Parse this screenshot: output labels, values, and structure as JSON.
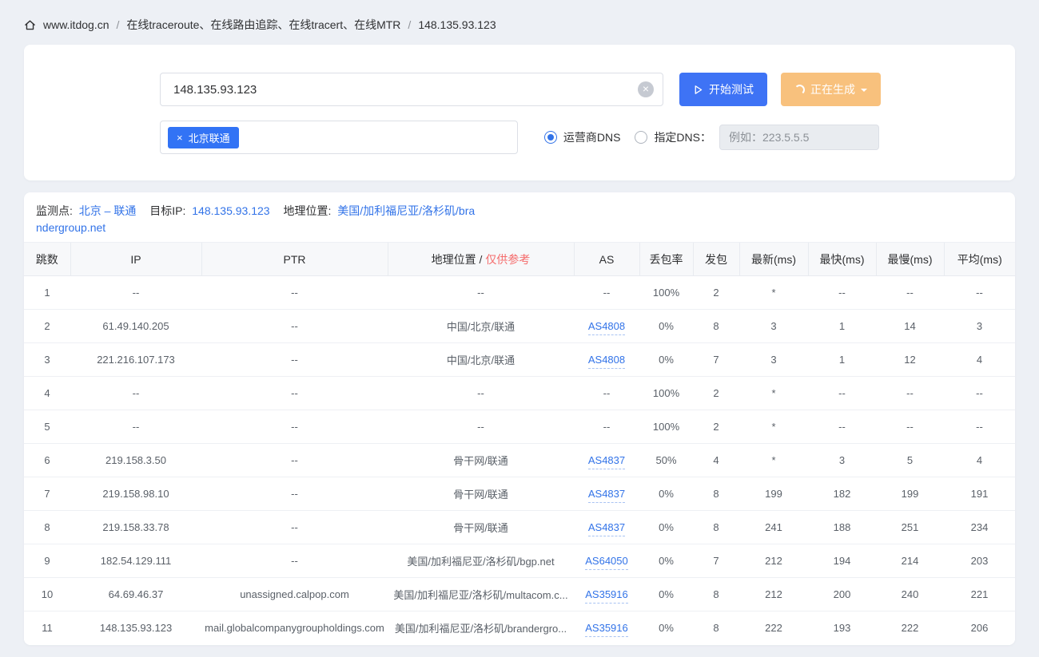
{
  "colors": {
    "accent_blue": "#3273e8",
    "button_blue": "#3e73f5",
    "generating_orange": "#f8c17d",
    "tag_blue": "#3273f5",
    "note_red": "#f56c6c",
    "page_background": "#edf0f5"
  },
  "breadcrumb": {
    "site": "www.itdog.cn",
    "sep1": "/",
    "section": "在线traceroute、在线路由追踪、在线tracert、在线MTR",
    "sep2": "/",
    "current": "148.135.93.123"
  },
  "controls": {
    "target_value": "148.135.93.123",
    "clear_glyph": "×",
    "start_label": "开始测试",
    "generating_label": "正在生成",
    "tag_close_glyph": "×",
    "tag_label": "北京联通",
    "radio_carrier_label": "运营商DNS",
    "radio_custom_label": "指定DNS：",
    "dns_example_value": "例如：223.5.5.5"
  },
  "result": {
    "monitor_label": "监测点:",
    "monitor_value": "北京 – 联通",
    "target_label": "目标IP:",
    "target_value": "148.135.93.123",
    "geo_label": "地理位置:",
    "geo_value": "美国/加利福尼亚/洛杉矶/brandergroup.net"
  },
  "table": {
    "headers": [
      "跳数",
      "IP",
      "PTR",
      "地理位置 / ",
      "AS",
      "丢包率",
      "发包",
      "最新(ms)",
      "最快(ms)",
      "最慢(ms)",
      "平均(ms)"
    ],
    "geo_note": "仅供参考",
    "rows": [
      {
        "hop": "1",
        "ip": "--",
        "ptr": "--",
        "geo": "--",
        "as": "--",
        "loss": "100%",
        "sent": "2",
        "latest": "*",
        "fastest": "--",
        "slowest": "--",
        "avg": "--"
      },
      {
        "hop": "2",
        "ip": "61.49.140.205",
        "ptr": "--",
        "geo": "中国/北京/联通",
        "as": "AS4808",
        "loss": "0%",
        "sent": "8",
        "latest": "3",
        "fastest": "1",
        "slowest": "14",
        "avg": "3"
      },
      {
        "hop": "3",
        "ip": "221.216.107.173",
        "ptr": "--",
        "geo": "中国/北京/联通",
        "as": "AS4808",
        "loss": "0%",
        "sent": "7",
        "latest": "3",
        "fastest": "1",
        "slowest": "12",
        "avg": "4"
      },
      {
        "hop": "4",
        "ip": "--",
        "ptr": "--",
        "geo": "--",
        "as": "--",
        "loss": "100%",
        "sent": "2",
        "latest": "*",
        "fastest": "--",
        "slowest": "--",
        "avg": "--"
      },
      {
        "hop": "5",
        "ip": "--",
        "ptr": "--",
        "geo": "--",
        "as": "--",
        "loss": "100%",
        "sent": "2",
        "latest": "*",
        "fastest": "--",
        "slowest": "--",
        "avg": "--"
      },
      {
        "hop": "6",
        "ip": "219.158.3.50",
        "ptr": "--",
        "geo": "骨干网/联通",
        "as": "AS4837",
        "loss": "50%",
        "sent": "4",
        "latest": "*",
        "fastest": "3",
        "slowest": "5",
        "avg": "4"
      },
      {
        "hop": "7",
        "ip": "219.158.98.10",
        "ptr": "--",
        "geo": "骨干网/联通",
        "as": "AS4837",
        "loss": "0%",
        "sent": "8",
        "latest": "199",
        "fastest": "182",
        "slowest": "199",
        "avg": "191"
      },
      {
        "hop": "8",
        "ip": "219.158.33.78",
        "ptr": "--",
        "geo": "骨干网/联通",
        "as": "AS4837",
        "loss": "0%",
        "sent": "8",
        "latest": "241",
        "fastest": "188",
        "slowest": "251",
        "avg": "234"
      },
      {
        "hop": "9",
        "ip": "182.54.129.111",
        "ptr": "--",
        "geo": "美国/加利福尼亚/洛杉矶/bgp.net",
        "as": "AS64050",
        "loss": "0%",
        "sent": "7",
        "latest": "212",
        "fastest": "194",
        "slowest": "214",
        "avg": "203"
      },
      {
        "hop": "10",
        "ip": "64.69.46.37",
        "ptr": "unassigned.calpop.com",
        "geo": "美国/加利福尼亚/洛杉矶/multacom.c...",
        "as": "AS35916",
        "loss": "0%",
        "sent": "8",
        "latest": "212",
        "fastest": "200",
        "slowest": "240",
        "avg": "221"
      },
      {
        "hop": "11",
        "ip": "148.135.93.123",
        "ptr": "mail.globalcompanygroupholdings.com",
        "geo": "美国/加利福尼亚/洛杉矶/brandergro...",
        "as": "AS35916",
        "loss": "0%",
        "sent": "8",
        "latest": "222",
        "fastest": "193",
        "slowest": "222",
        "avg": "206"
      }
    ]
  }
}
